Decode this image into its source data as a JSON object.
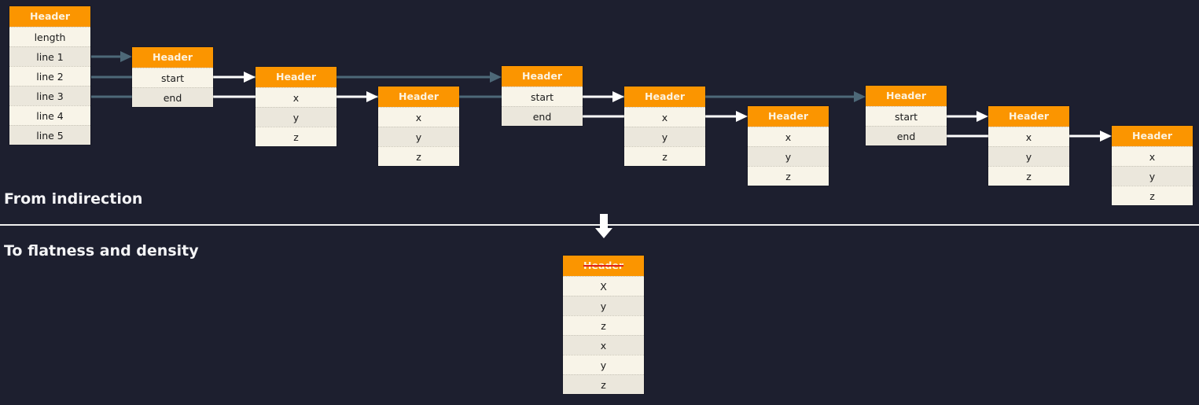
{
  "colors": {
    "background": "#1d1f2f",
    "header": "#fb9500",
    "header_text": "#fdf3df",
    "row_light": "#f8f4e8",
    "row_dark": "#ebe7dc",
    "pointer_link": "#4d6878",
    "value_link": "#ffffff",
    "strike": "#e0201a"
  },
  "captions": {
    "top": "From indirection",
    "bottom": "To flatness and density"
  },
  "nodes": [
    {
      "id": "root",
      "header": "Header",
      "rows": [
        "length",
        "line 1",
        "line 2",
        "line 3",
        "line 4",
        "line 5"
      ]
    },
    {
      "id": "line1",
      "header": "Header",
      "rows": [
        "start",
        "end"
      ]
    },
    {
      "id": "line1-start",
      "header": "Header",
      "rows": [
        "x",
        "y",
        "z"
      ]
    },
    {
      "id": "line1-end",
      "header": "Header",
      "rows": [
        "x",
        "y",
        "z"
      ]
    },
    {
      "id": "line2",
      "header": "Header",
      "rows": [
        "start",
        "end"
      ]
    },
    {
      "id": "line2-start",
      "header": "Header",
      "rows": [
        "x",
        "y",
        "z"
      ]
    },
    {
      "id": "line2-end",
      "header": "Header",
      "rows": [
        "x",
        "y",
        "z"
      ]
    },
    {
      "id": "line3",
      "header": "Header",
      "rows": [
        "start",
        "end"
      ]
    },
    {
      "id": "line3-start",
      "header": "Header",
      "rows": [
        "x",
        "y",
        "z"
      ]
    },
    {
      "id": "line3-end",
      "header": "Header",
      "rows": [
        "x",
        "y",
        "z"
      ]
    }
  ],
  "flat": {
    "header": "Header",
    "header_struck": true,
    "rows": [
      "X",
      "y",
      "z",
      "x",
      "y",
      "z"
    ]
  },
  "links": [
    {
      "from": "root.line 1",
      "to": "line1",
      "kind": "pointer"
    },
    {
      "from": "root.line 2",
      "to": "line2",
      "kind": "pointer"
    },
    {
      "from": "root.line 3",
      "to": "line3",
      "kind": "pointer"
    },
    {
      "from": "line1.start",
      "to": "line1-start",
      "kind": "value"
    },
    {
      "from": "line1.end",
      "to": "line1-end",
      "kind": "value"
    },
    {
      "from": "line2.start",
      "to": "line2-start",
      "kind": "value"
    },
    {
      "from": "line2.end",
      "to": "line2-end",
      "kind": "value"
    },
    {
      "from": "line3.start",
      "to": "line3-start",
      "kind": "value"
    },
    {
      "from": "line3.end",
      "to": "line3-end",
      "kind": "value"
    }
  ]
}
